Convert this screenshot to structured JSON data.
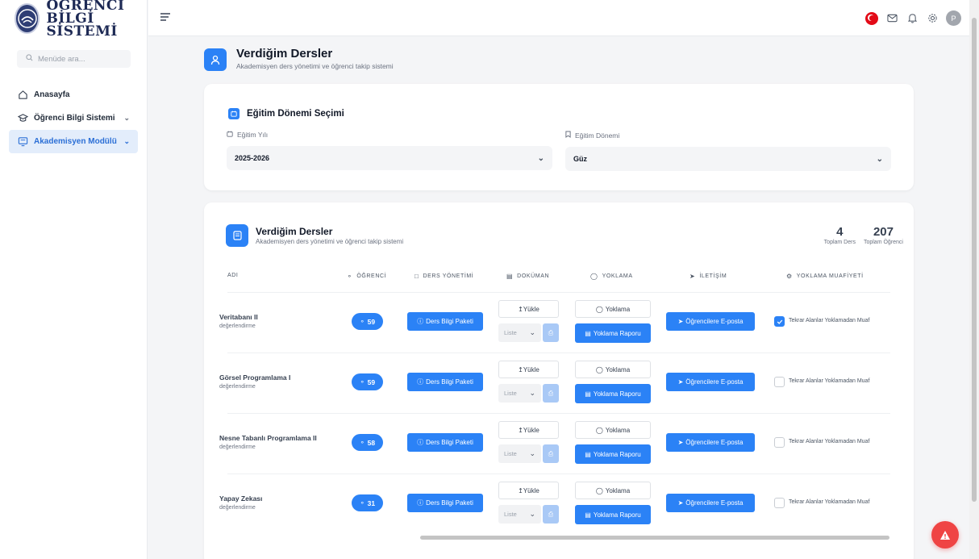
{
  "brand": {
    "line1": "ÖĞRENCİ",
    "line2": "BİLGİ SİSTEMİ"
  },
  "sidebar": {
    "search_placeholder": "Menüde ara...",
    "items": [
      {
        "label": "Anasayfa",
        "icon": "home-icon",
        "active": false,
        "has_children": false
      },
      {
        "label": "Öğrenci Bilgi Sistemi",
        "icon": "graduation-cap-icon",
        "active": false,
        "has_children": true
      },
      {
        "label": "Akademisyen Modülü",
        "icon": "presentation-board-icon",
        "active": true,
        "has_children": true
      }
    ]
  },
  "topbar": {
    "avatar_initial": "P"
  },
  "page": {
    "title": "Verdiğim Dersler",
    "subtitle": "Akademisyen ders yönetimi ve öğrenci takip sistemi"
  },
  "term_card": {
    "title": "Eğitim Dönemi Seçimi",
    "year_label": "Eğitim Yılı",
    "year_value": "2025-2026",
    "term_label": "Eğitim Dönemi",
    "term_value": "Güz"
  },
  "courses_card": {
    "title": "Verdiğim Dersler",
    "subtitle": "Akademisyen ders yönetimi ve öğrenci takip sistemi",
    "total_courses": "4",
    "total_courses_label": "Toplam Ders",
    "total_students": "207",
    "total_students_label": "Toplam Öğrenci",
    "columns": [
      "ADI",
      "ÖĞRENCİ",
      "DERS YÖNETİMİ",
      "DOKÜMAN",
      "YOKLAMA",
      "İLETİŞİM",
      "YOKLAMA MUAFİYETİ"
    ],
    "actions": {
      "info_package": "Ders Bilgi Paketi",
      "upload": "Yükle",
      "list": "Liste",
      "attendance": "Yoklama",
      "attendance_report": "Yoklama Raporu",
      "email": "Öğrencilere E-posta",
      "exempt": "Tekrar Alanlar Yoklamadan Muaf"
    },
    "rows": [
      {
        "name": "Veritabanı II",
        "desc": "değerlendirme",
        "students": "59",
        "exempt": true
      },
      {
        "name": "Görsel Programlama I",
        "desc": "değerlendirme",
        "students": "59",
        "exempt": false
      },
      {
        "name": "Nesne Tabanlı Programlama II",
        "desc": "değerlendirme",
        "students": "58",
        "exempt": false
      },
      {
        "name": "Yapay Zekası",
        "desc": "değerlendirme",
        "students": "31",
        "exempt": false
      }
    ]
  },
  "colors": {
    "primary": "#2b82f6",
    "brand": "#1e2a55",
    "danger": "#ef4444"
  }
}
